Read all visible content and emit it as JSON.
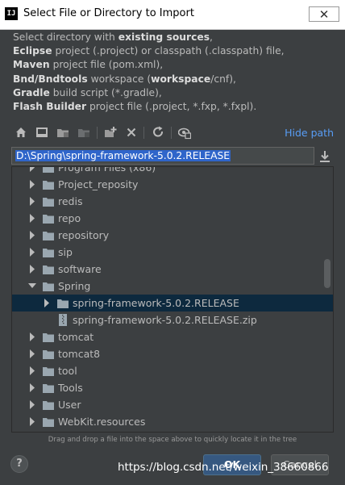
{
  "window": {
    "app_icon_text": "IJ",
    "title": "Select File or Directory to Import",
    "close_label": "✕"
  },
  "description": [
    [
      {
        "t": "Select directory with "
      },
      {
        "t": "existing sources",
        "b": true
      },
      {
        "t": ","
      }
    ],
    [
      {
        "t": "Eclipse",
        "b": true
      },
      {
        "t": " project (.project) or classpath (.classpath) file,"
      }
    ],
    [
      {
        "t": "Maven",
        "b": true
      },
      {
        "t": " project file (pom.xml),"
      }
    ],
    [
      {
        "t": "Bnd/Bndtools",
        "b": true
      },
      {
        "t": " workspace ("
      },
      {
        "t": "workspace",
        "b": true
      },
      {
        "t": "/cnf),"
      }
    ],
    [
      {
        "t": "Gradle",
        "b": true
      },
      {
        "t": " build script (*.gradle),"
      }
    ],
    [
      {
        "t": "Flash Builder",
        "b": true
      },
      {
        "t": " project file (.project, *.fxp, *.fxpl)."
      }
    ]
  ],
  "toolbar": {
    "icons": [
      "home-icon",
      "desktop-icon",
      "project-folder-icon",
      "module-folder-icon",
      "new-folder-icon",
      "delete-icon",
      "refresh-icon",
      "show-hidden-icon"
    ],
    "hide_path_label": "Hide path"
  },
  "path": {
    "value": "D:\\Spring\\spring-framework-5.0.2.RELEASE"
  },
  "tree": {
    "rows": [
      {
        "label": "Program Files (x86)",
        "level": 0,
        "state": "collapsed",
        "type": "folder"
      },
      {
        "label": "Project_reposity",
        "level": 0,
        "state": "collapsed",
        "type": "folder"
      },
      {
        "label": "redis",
        "level": 0,
        "state": "collapsed",
        "type": "folder"
      },
      {
        "label": "repo",
        "level": 0,
        "state": "collapsed",
        "type": "folder"
      },
      {
        "label": "repository",
        "level": 0,
        "state": "collapsed",
        "type": "folder"
      },
      {
        "label": "sip",
        "level": 0,
        "state": "collapsed",
        "type": "folder"
      },
      {
        "label": "software",
        "level": 0,
        "state": "collapsed",
        "type": "folder"
      },
      {
        "label": "Spring",
        "level": 0,
        "state": "expanded",
        "type": "folder"
      },
      {
        "label": "spring-framework-5.0.2.RELEASE",
        "level": 1,
        "state": "collapsed",
        "type": "folder",
        "selected": true
      },
      {
        "label": "spring-framework-5.0.2.RELEASE.zip",
        "level": 1,
        "state": "none",
        "type": "zip"
      },
      {
        "label": "tomcat",
        "level": 0,
        "state": "collapsed",
        "type": "folder"
      },
      {
        "label": "tomcat8",
        "level": 0,
        "state": "collapsed",
        "type": "folder"
      },
      {
        "label": "tool",
        "level": 0,
        "state": "collapsed",
        "type": "folder"
      },
      {
        "label": "Tools",
        "level": 0,
        "state": "collapsed",
        "type": "folder"
      },
      {
        "label": "User",
        "level": 0,
        "state": "collapsed",
        "type": "folder"
      },
      {
        "label": "WebKit.resources",
        "level": 0,
        "state": "collapsed",
        "type": "folder"
      }
    ]
  },
  "hint": "Drag and drop a file into the space above to quickly locate it in the tree",
  "buttons": {
    "help": "?",
    "ok": "OK",
    "cancel": "Cancel"
  },
  "watermark": "https://blog.csdn.net/weixin_38660866",
  "colors": {
    "background": "#3c3f41",
    "accent_link": "#589df6",
    "selection": "#0d293e",
    "path_selection": "#2f65ca",
    "ok_button": "#365880"
  }
}
